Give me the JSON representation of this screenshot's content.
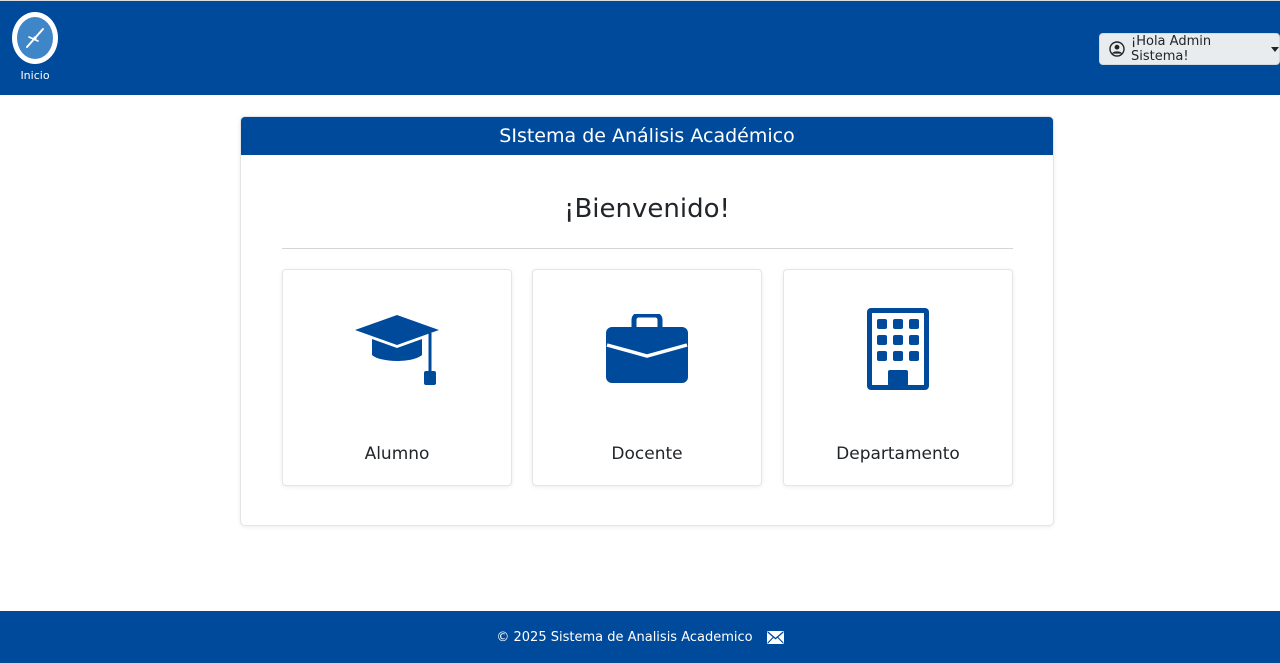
{
  "navbar": {
    "brand_label": "Inicio",
    "brand_icon": "compass-logo-icon",
    "user_menu_label": "¡Hola Admin Sistema!",
    "user_icon": "user-circle-icon",
    "color": "#004a9c"
  },
  "card": {
    "header_title": "SIstema de Análisis Académico",
    "welcome_text": "¡Bienvenido!"
  },
  "tiles": [
    {
      "label": "Alumno",
      "icon": "graduation-cap-icon"
    },
    {
      "label": "Docente",
      "icon": "briefcase-icon"
    },
    {
      "label": "Departamento",
      "icon": "building-icon"
    }
  ],
  "footer": {
    "text": "© 2025 Sistema de Analisis Academico",
    "icon": "envelope-icon"
  },
  "colors": {
    "primary": "#004a9c",
    "icon": "#004a9c",
    "user_button_bg": "#e9ecef"
  }
}
